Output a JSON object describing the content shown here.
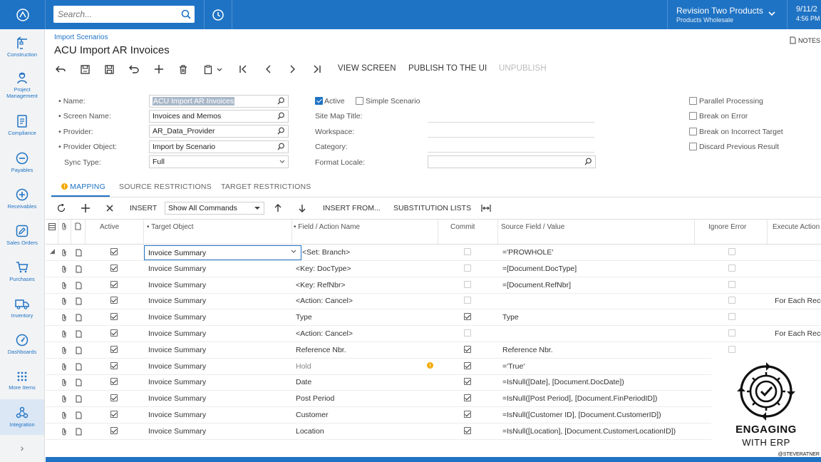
{
  "topbar": {
    "search_placeholder": "Search...",
    "company_name": "Revision Two Products",
    "company_branch": "Products Wholesale",
    "date": "9/11/2",
    "time": "4:56 PM"
  },
  "nav": {
    "items": [
      {
        "label": "Construction",
        "icon": "crane-icon"
      },
      {
        "label": "Project Management",
        "icon": "worker-icon"
      },
      {
        "label": "Compliance",
        "icon": "document-icon"
      },
      {
        "label": "Payables",
        "icon": "minus-circle-icon"
      },
      {
        "label": "Receivables",
        "icon": "plus-circle-icon"
      },
      {
        "label": "Sales Orders",
        "icon": "pencil-icon"
      },
      {
        "label": "Purchases",
        "icon": "cart-icon"
      },
      {
        "label": "Inventory",
        "icon": "truck-icon"
      },
      {
        "label": "Dashboards",
        "icon": "gauge-icon"
      },
      {
        "label": "More Items",
        "icon": "grid-dots-icon"
      },
      {
        "label": "Integration",
        "icon": "integration-icon"
      }
    ],
    "active": "Integration",
    "expand": "›"
  },
  "header": {
    "breadcrumb": "Import Scenarios",
    "title": "ACU Import AR Invoices",
    "notes": "NOTES"
  },
  "toolbar": {
    "view_screen": "VIEW SCREEN",
    "publish": "PUBLISH TO THE UI",
    "unpublish": "UNPUBLISH"
  },
  "form": {
    "name_label": "Name:",
    "name_value": "ACU Import AR Invoices",
    "screen_label": "Screen Name:",
    "screen_value": "Invoices and Memos",
    "provider_label": "Provider:",
    "provider_value": "AR_Data_Provider",
    "provider_object_label": "Provider Object:",
    "provider_object_value": "Import by Scenario",
    "sync_label": "Sync Type:",
    "sync_value": "Full",
    "active_label": "Active",
    "active_checked": true,
    "simple_label": "Simple Scenario",
    "simple_checked": false,
    "sitemap_label": "Site Map Title:",
    "workspace_label": "Workspace:",
    "category_label": "Category:",
    "locale_label": "Format Locale:",
    "parallel_label": "Parallel Processing",
    "break_error_label": "Break on Error",
    "break_target_label": "Break on Incorrect Target",
    "discard_label": "Discard Previous Result"
  },
  "tabs": {
    "mapping": "MAPPING",
    "source": "SOURCE RESTRICTIONS",
    "target": "TARGET RESTRICTIONS"
  },
  "grid_toolbar": {
    "insert": "INSERT",
    "command_filter": "Show All Commands",
    "insert_from": "INSERT FROM...",
    "substitution": "SUBSTITUTION LISTS"
  },
  "grid": {
    "headers": {
      "active": "Active",
      "target_object": "Target Object",
      "field_action": "Field / Action Name",
      "commit": "Commit",
      "source_field": "Source Field / Value",
      "ignore_error": "Ignore Error",
      "execute_action": "Execute Action"
    },
    "rows": [
      {
        "target": "Invoice Summary",
        "field": "<Set: Branch>",
        "commit": false,
        "commit_dim": true,
        "source": "='PROWHOLE'",
        "execute": "",
        "editing": true
      },
      {
        "target": "Invoice Summary",
        "field": "<Key: DocType>",
        "commit": false,
        "commit_dim": true,
        "source": "=[Document.DocType]",
        "execute": ""
      },
      {
        "target": "Invoice Summary",
        "field": "<Key: RefNbr>",
        "commit": false,
        "commit_dim": true,
        "source": "=[Document.RefNbr]",
        "execute": ""
      },
      {
        "target": "Invoice Summary",
        "field": "<Action: Cancel>",
        "commit": false,
        "commit_dim": true,
        "source": "",
        "execute": "For Each Reco"
      },
      {
        "target": "Invoice Summary",
        "field": "Type",
        "commit": true,
        "source": "Type",
        "execute": ""
      },
      {
        "target": "Invoice Summary",
        "field": "<Action: Cancel>",
        "commit": false,
        "commit_dim": true,
        "source": "",
        "execute": "For Each Reco"
      },
      {
        "target": "Invoice Summary",
        "field": "Reference Nbr.",
        "commit": true,
        "source": "Reference Nbr.",
        "execute": ""
      },
      {
        "target": "Invoice Summary",
        "field": "Hold",
        "commit": true,
        "source": "='True'",
        "execute": "",
        "warning": true
      },
      {
        "target": "Invoice Summary",
        "field": "Date",
        "commit": true,
        "source": "=IsNull([Date], [Document.DocDate])",
        "execute": ""
      },
      {
        "target": "Invoice Summary",
        "field": "Post Period",
        "commit": true,
        "source": "=IsNull([Post Period], [Document.FinPeriodID])",
        "execute": ""
      },
      {
        "target": "Invoice Summary",
        "field": "Customer",
        "commit": true,
        "source": "=IsNull([Customer ID], [Document.CustomerID])",
        "execute": ""
      },
      {
        "target": "Invoice Summary",
        "field": "Location",
        "commit": true,
        "source": "=IsNull([Location], [Document.CustomerLocationID])",
        "execute": ""
      }
    ]
  },
  "brand": {
    "title": "ENGAGING",
    "subtitle": "WITH ERP",
    "handle": "@STEVERATNER"
  },
  "colors": {
    "primary": "#1f73c4",
    "warning": "#f2a900"
  }
}
